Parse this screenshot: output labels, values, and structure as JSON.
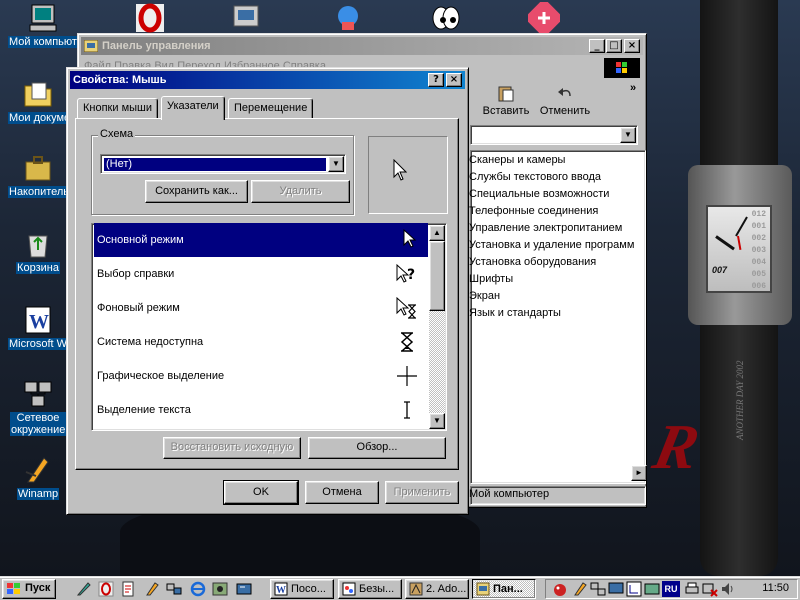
{
  "desktop": {
    "icons": [
      {
        "label": "Мой компьютер",
        "icon": "my-computer-icon"
      },
      {
        "label": "Мои документы",
        "icon": "my-documents-icon"
      },
      {
        "label": "Накопитель",
        "icon": "briefcase-icon"
      },
      {
        "label": "Корзина",
        "icon": "recycle-bin-icon"
      },
      {
        "label": "Microsoft Word",
        "icon": "word-icon"
      },
      {
        "label": "Сетевое окружение",
        "icon": "network-icon"
      },
      {
        "label": "Winamp",
        "icon": "winamp-icon"
      }
    ],
    "watch": {
      "brand": "007",
      "numbers": [
        "012",
        "001",
        "002",
        "003",
        "004",
        "005",
        "006"
      ],
      "strap_text": "ANOTHER DAY 2002"
    },
    "wallpaper_text": "R D"
  },
  "control_panel": {
    "title": "Панель управления",
    "menu_partial": "Файл  Правка  Вид  Переход  Избранное  Справка",
    "toolbar": {
      "paste": "Вставить",
      "undo": "Отменить",
      "more": "»"
    },
    "items": [
      "Сканеры и камеры",
      "Службы текстового ввода",
      "Специальные возможности",
      "Телефонные соединения",
      "Управление электропитанием",
      "Установка и удаление программ",
      "Установка оборудования",
      "Шрифты",
      "Экран",
      "Язык и стандарты"
    ],
    "status": "Мой компьютер"
  },
  "dialog": {
    "title": "Свойства: Мышь",
    "help": "?",
    "close": "×",
    "tabs": [
      "Кнопки мыши",
      "Указатели",
      "Перемещение"
    ],
    "active_tab": "Указатели",
    "scheme_label": "Схема",
    "scheme_value": "(Нет)",
    "save_as": "Сохранить как...",
    "delete": "Удалить",
    "pointers": [
      {
        "label": "Основной режим",
        "cursor": "arrow-cursor-icon"
      },
      {
        "label": "Выбор справки",
        "cursor": "help-cursor-icon"
      },
      {
        "label": "Фоновый режим",
        "cursor": "working-cursor-icon"
      },
      {
        "label": "Система недоступна",
        "cursor": "hourglass-cursor-icon"
      },
      {
        "label": "Графическое выделение",
        "cursor": "crosshair-cursor-icon"
      },
      {
        "label": "Выделение текста",
        "cursor": "text-cursor-icon"
      }
    ],
    "restore_default": "Восстановить исходную",
    "browse": "Обзор...",
    "ok": "OK",
    "cancel": "Отмена",
    "apply": "Применить"
  },
  "taskbar": {
    "start": "Пуск",
    "tasks": [
      "Посо...",
      "Безы...",
      "2. Ado...",
      "Пан..."
    ],
    "clock": "11:50",
    "lang": "RU"
  }
}
